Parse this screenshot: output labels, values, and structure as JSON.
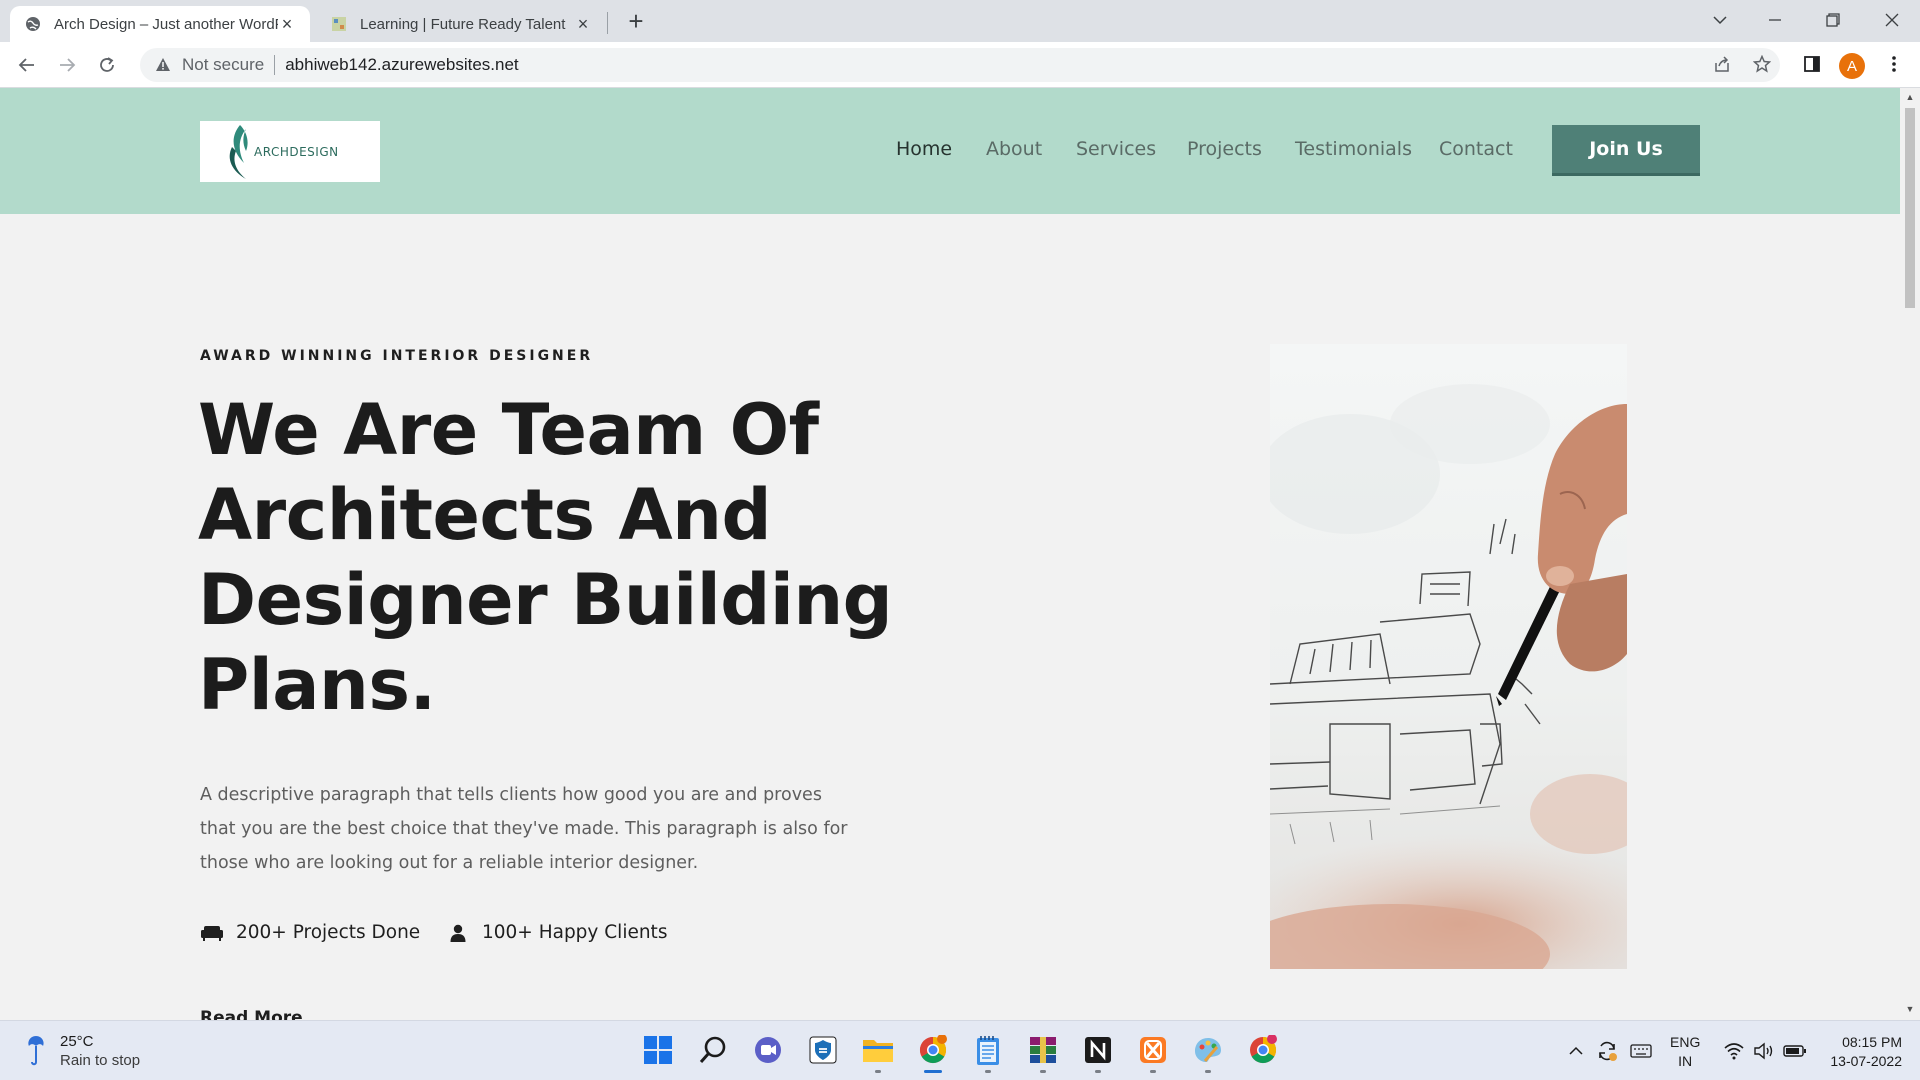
{
  "browser": {
    "tabs": [
      {
        "title": "Arch Design – Just another WordPress site",
        "active": true
      },
      {
        "title": "Learning | Future Ready Talent",
        "active": false
      }
    ],
    "security_label": "Not secure",
    "url": "abhiweb142.azurewebsites.net",
    "profile_initial": "A"
  },
  "site": {
    "logo_text": "ARCHDESIGN",
    "nav": [
      "Home",
      "About",
      "Services",
      "Projects",
      "Testimonials",
      "Contact"
    ],
    "cta": "Join Us",
    "accent_color": "#b2dacb",
    "button_color": "#4f8077"
  },
  "hero": {
    "eyebrow": "AWARD WINNING INTERIOR DESIGNER",
    "title": "We Are Team Of Architects And Designer Building Plans.",
    "description": "A descriptive paragraph that tells clients how good you are and proves that you are the best choice that they've made. This paragraph is also for those who are looking out for a reliable interior designer.",
    "stats": [
      {
        "icon": "couch-icon",
        "label": "200+ Projects Done"
      },
      {
        "icon": "user-icon",
        "label": "100+ Happy Clients"
      }
    ],
    "read_more": "Read More"
  },
  "taskbar": {
    "weather_temp": "25°C",
    "weather_condition": "Rain to stop",
    "apps": [
      "windows-start-icon",
      "search-icon",
      "teams-chat-icon",
      "shield-app-icon",
      "file-explorer-icon",
      "chrome-icon",
      "notepad-icon",
      "winrar-icon",
      "notion-icon",
      "xampp-icon",
      "paint-icon",
      "chrome-profile-icon"
    ],
    "language": "ENG",
    "region": "IN",
    "time": "08:15 PM",
    "date": "13-07-2022"
  }
}
